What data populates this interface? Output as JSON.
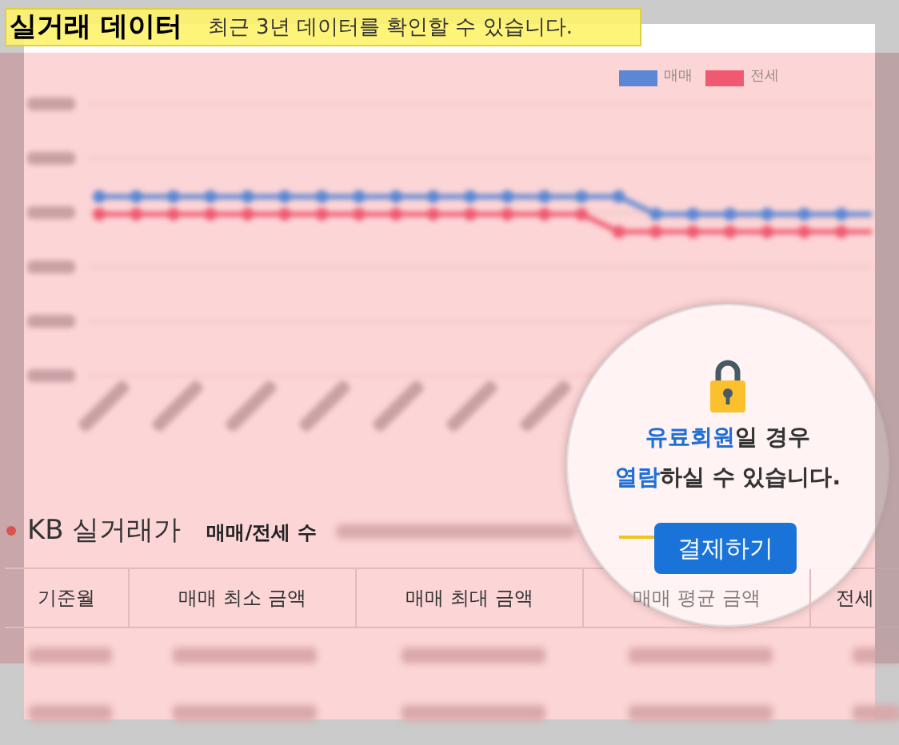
{
  "header": {
    "title": "실거래 데이터",
    "subtitle": "최근 3년 데이터를 확인할 수 있습니다."
  },
  "legend": [
    {
      "label": "매매",
      "color": "#5b87d4"
    },
    {
      "label": "전세",
      "color": "#ef5a72"
    }
  ],
  "section": {
    "title": "KB 실거래가",
    "filter": "매매/전세 수"
  },
  "table": {
    "columns": [
      "기준월",
      "매매 최소 금액",
      "매매 최대 금액",
      "매매 평균 금액",
      "전세"
    ]
  },
  "paywall": {
    "lines": [
      [
        {
          "text": "유료회원",
          "highlight": true
        },
        {
          "text": "일 경우",
          "highlight": false
        }
      ],
      [
        {
          "text": "열람",
          "highlight": true
        },
        {
          "text": "하실 수 있습니다.",
          "highlight": false
        }
      ]
    ],
    "button": "결제하기"
  }
}
